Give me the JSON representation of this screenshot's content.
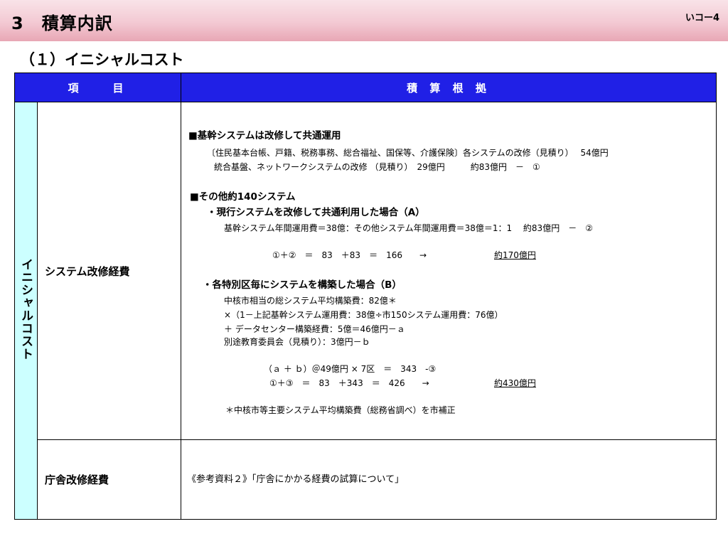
{
  "header": {
    "title": "3　積算内訳",
    "page_number": "いコー4"
  },
  "section": {
    "heading": "（１）イニシャルコスト"
  },
  "table": {
    "col_item": "項　　目",
    "col_basis": "積 算 根 拠",
    "group_label": "イニシャルコスト",
    "rows": [
      {
        "item": "システム改修経費",
        "lines": [
          "■基幹システムは改修して共通運用",
          "〔住民基本台帳、戸籍、税務事務、総合福祉、国保等、介護保険〕各システムの改修（見積り）　 54億円",
          "統合基盤、ネットワークシステムの改修 （見積り）　29億円　　　約83億円　－　①",
          "■その他約140システム",
          "・現行システムを改修して共通利用した場合（A）",
          "基幹システム年間運用費＝38億：その他システム年間運用費＝38億＝1：1　 約83億円　－　②",
          "①＋②　＝　83　＋83　＝　166　　→",
          "約170億円",
          "・各特別区毎にシステムを構築した場合（B）",
          "中核市相当の総システム平均構築費：82億＊",
          "×（1－上記基幹システム運用費：38億÷市150システム運用費：76億）",
          "＋ データセンター構築経費：5億＝46億円－ａ",
          "別途教育委員会（見積り）：3億円－ｂ",
          "（ａ ＋ ｂ）＠49億円 × 7区　＝　343　-③",
          "①＋③　＝　83　＋343　＝　426　　→",
          "約430億円",
          "＊中核市等主要システム平均構築費（総務省調べ）を市補正"
        ]
      },
      {
        "item": "庁舎改修経費",
        "lines": [
          "《参考資料２》「庁舎にかかる経費の試算について」"
        ]
      }
    ]
  }
}
